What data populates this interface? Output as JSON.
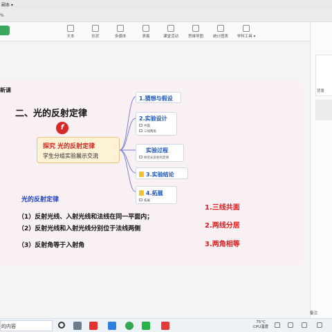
{
  "window": {
    "title": "副本 ▾",
    "tab_fragment": "%"
  },
  "toolbar": {
    "items": [
      {
        "label": "文本",
        "icon": "text-icon"
      },
      {
        "label": "形状",
        "icon": "shape-icon"
      },
      {
        "label": "多媒体",
        "icon": "media-icon"
      },
      {
        "label": "表格",
        "icon": "table-icon"
      },
      {
        "label": "课堂活动",
        "icon": "activity-icon"
      },
      {
        "label": "思维导图",
        "icon": "mindmap-icon"
      },
      {
        "label": "统计图表",
        "icon": "chart-icon"
      },
      {
        "label": "学科工具 ▾",
        "icon": "subject-tools-icon"
      }
    ],
    "accent": "#3aa85a"
  },
  "right_panel": {
    "background_label": "背景"
  },
  "slide": {
    "section_title": "新课",
    "main_title": "二、光的反射定律",
    "flash_glyph": "f",
    "center_node": {
      "line1": "探究 光的反射定律",
      "line2": "学生分组实验展示交流"
    },
    "nodes": [
      {
        "title": "1.猜想与假设",
        "subs": []
      },
      {
        "title": "2.实验设计",
        "subs": [
          "共面",
          "三线两角"
        ]
      },
      {
        "title": "实验过程",
        "subs": [
          "探究光反射的定律"
        ]
      },
      {
        "title": "3.实验结论",
        "subs": []
      },
      {
        "title": "4.拓展",
        "subs": [
          "拓展"
        ]
      }
    ],
    "law_title": "光的反射定律",
    "laws": [
      "（1）反射光线、入射光线和法线在同一平面内；",
      "（2）反射光线和入射光线分别位于法线两侧",
      "（3）反射角等于入射角"
    ],
    "summary": [
      "1.三线共面",
      "2.两线分居",
      "3.两角相等"
    ]
  },
  "status": {
    "notes_label": "备注"
  },
  "taskbar": {
    "search_text": "的内容",
    "weather_temp": "75°C",
    "weather_label": "CPU温度"
  }
}
